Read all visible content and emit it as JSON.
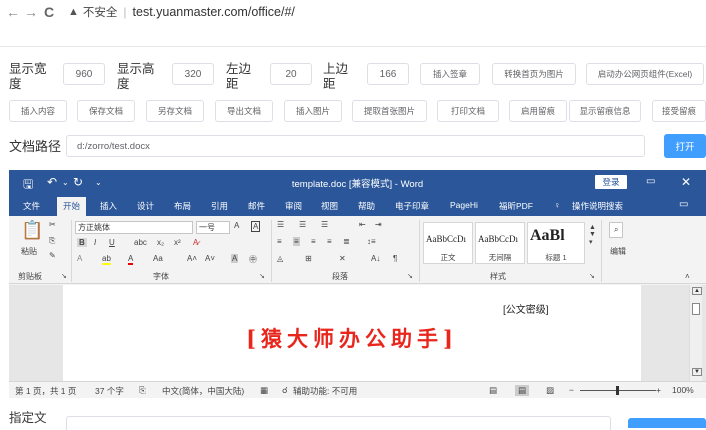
{
  "browser": {
    "back": "←",
    "forward": "→",
    "reload": "C",
    "security": "不安全",
    "url": "test.yuanmaster.com/office/#/"
  },
  "config": {
    "width_label": "显示宽度",
    "width_value": "960",
    "height_label": "显示高度",
    "height_value": "320",
    "left_label": "左边距",
    "left_value": "20",
    "top_label": "上边距",
    "top_value": "166",
    "btn_insert_sign": "插入签章",
    "btn_first_page_img": "转换首页为图片",
    "btn_launch": "启动办公网页组件(Excel)"
  },
  "actions": [
    "插入内容",
    "保存文档",
    "另存文档",
    "导出文档",
    "插入图片",
    "提取首张图片",
    "打印文档",
    "启用留痕",
    "显示留痕信息",
    "接受留痕"
  ],
  "path": {
    "label": "文档路径",
    "value": "d:/zorro/test.docx",
    "open": "打开"
  },
  "word": {
    "title": "template.doc [兼容模式] - Word",
    "login": "登录",
    "tabs": [
      "文件",
      "开始",
      "插入",
      "设计",
      "布局",
      "引用",
      "邮件",
      "审阅",
      "视图",
      "帮助",
      "电子印章",
      "PageHi",
      "福昕PDF",
      "操作说明搜索"
    ],
    "active_tab": "开始",
    "clipboard": {
      "paste": "粘贴",
      "group": "剪贴板"
    },
    "font": {
      "name": "方正姚体",
      "size": "一号",
      "group": "字体"
    },
    "paragraph": {
      "group": "段落"
    },
    "styles": {
      "group": "样式",
      "items": [
        {
          "sample": "AaBbCcDı",
          "name": "正文"
        },
        {
          "sample": "AaBbCcDı",
          "name": "无间隔"
        },
        {
          "sample": "AaBl",
          "name": "标题 1"
        }
      ]
    },
    "edit": {
      "label": "编辑"
    },
    "doc": {
      "stamp_label": "[公文密级]",
      "title": "[猿大师办公助手]"
    },
    "status": {
      "page": "第 1 页，共 1 页",
      "words": "37 个字",
      "lang": "中文(简体，中国大陆)",
      "access": "辅助功能: 不可用",
      "zoom": "100%"
    }
  },
  "bottom": {
    "label": "指定文"
  }
}
